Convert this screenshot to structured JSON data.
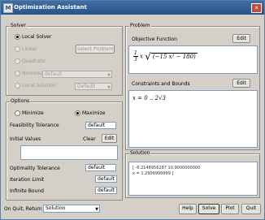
{
  "window": {
    "title": "Optimization Assistant",
    "app_icon": "M"
  },
  "solve_panel": {
    "label": "Solver",
    "options": [
      "Local Solver",
      "Linear",
      "Quadratic",
      "Nonlinear",
      "Local Solution"
    ],
    "selected": 0,
    "problem_button": "Select Problem",
    "nonlinear_value": "default",
    "local_value": "Default"
  },
  "options_panel": {
    "label": "Options",
    "minimize": "Minimize",
    "maximize": "Maximize",
    "feasibility_label": "Feasibility Tolerance",
    "feasibility_value": "default",
    "initial_label": "Initial Values",
    "clear_btn": "Clear",
    "edit_btn": "Edit",
    "optimality_label": "Optimality Tolerance",
    "optimality_value": "default",
    "iteration_label": "Iteration Limit",
    "iteration_value": "default",
    "infinite_label": "Infinite Bound",
    "infinite_value": "default"
  },
  "problem_panel": {
    "label": "Problem",
    "objective_label": "Objective Function",
    "objective_edit": "Edit",
    "constraints_label": "Constraints and Bounds",
    "constraints_edit": "Edit"
  },
  "solution_panel": {
    "label": "Solution",
    "lines": [
      "[ -6.2148956287  10.9000000000",
      "  x = 1.2999999999  ]"
    ]
  },
  "footer": {
    "quit_label": "On Quit, Return",
    "quit_value": "Solution",
    "help": "Help",
    "solve": "Solve",
    "plot": "Plot",
    "quit": "Quit"
  }
}
